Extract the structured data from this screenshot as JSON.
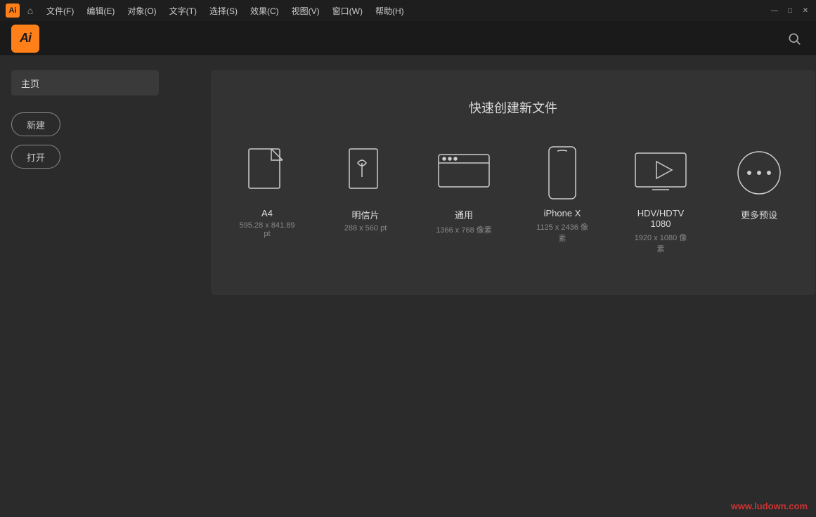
{
  "titlebar": {
    "ai_logo": "Ai",
    "menus": [
      {
        "label": "文件(F)"
      },
      {
        "label": "编辑(E)"
      },
      {
        "label": "对象(O)"
      },
      {
        "label": "文字(T)"
      },
      {
        "label": "选择(S)"
      },
      {
        "label": "效果(C)"
      },
      {
        "label": "视图(V)"
      },
      {
        "label": "窗口(W)"
      },
      {
        "label": "帮助(H)"
      }
    ],
    "controls": {
      "minimize": "—",
      "restore": "□",
      "close": "✕"
    }
  },
  "header": {
    "ai_logo": "Ai",
    "search_icon": "🔍"
  },
  "sidebar": {
    "home_tab": "主页",
    "new_btn": "新建",
    "open_btn": "打开"
  },
  "main": {
    "quick_create_title": "快速创建新文件",
    "presets": [
      {
        "name": "A4",
        "size": "595.28 x 841.89 pt",
        "icon_type": "document"
      },
      {
        "name": "明信片",
        "size": "288 x 560 pt",
        "icon_type": "postcard"
      },
      {
        "name": "通用",
        "size": "1366 x 768 像素",
        "icon_type": "screen"
      },
      {
        "name": "iPhone X",
        "size": "1125 x 2436 像素",
        "icon_type": "phone"
      },
      {
        "name": "HDV/HDTV 1080",
        "size": "1920 x 1080 像素",
        "icon_type": "video"
      },
      {
        "name": "更多预设",
        "size": "",
        "icon_type": "more"
      }
    ]
  },
  "watermark": "www.ludown.com"
}
